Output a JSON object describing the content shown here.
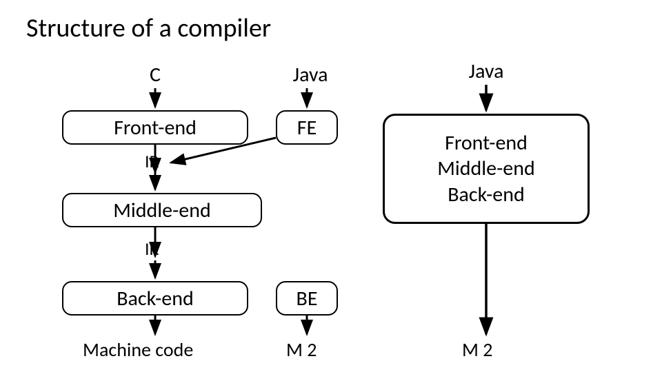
{
  "title": "Structure of a compiler",
  "left": {
    "input1": "C",
    "input2": "Java",
    "frontend": "Front-end",
    "fe": "FE",
    "ir1": "IR",
    "middleend": "Middle-end",
    "ir2": "IR",
    "backend": "Back-end",
    "be": "BE",
    "output1": "Machine code",
    "output2": "M 2"
  },
  "right": {
    "input": "Java",
    "box_line1": "Front-end",
    "box_line2": "Middle-end",
    "box_line3": "Back-end",
    "output": "M 2"
  }
}
